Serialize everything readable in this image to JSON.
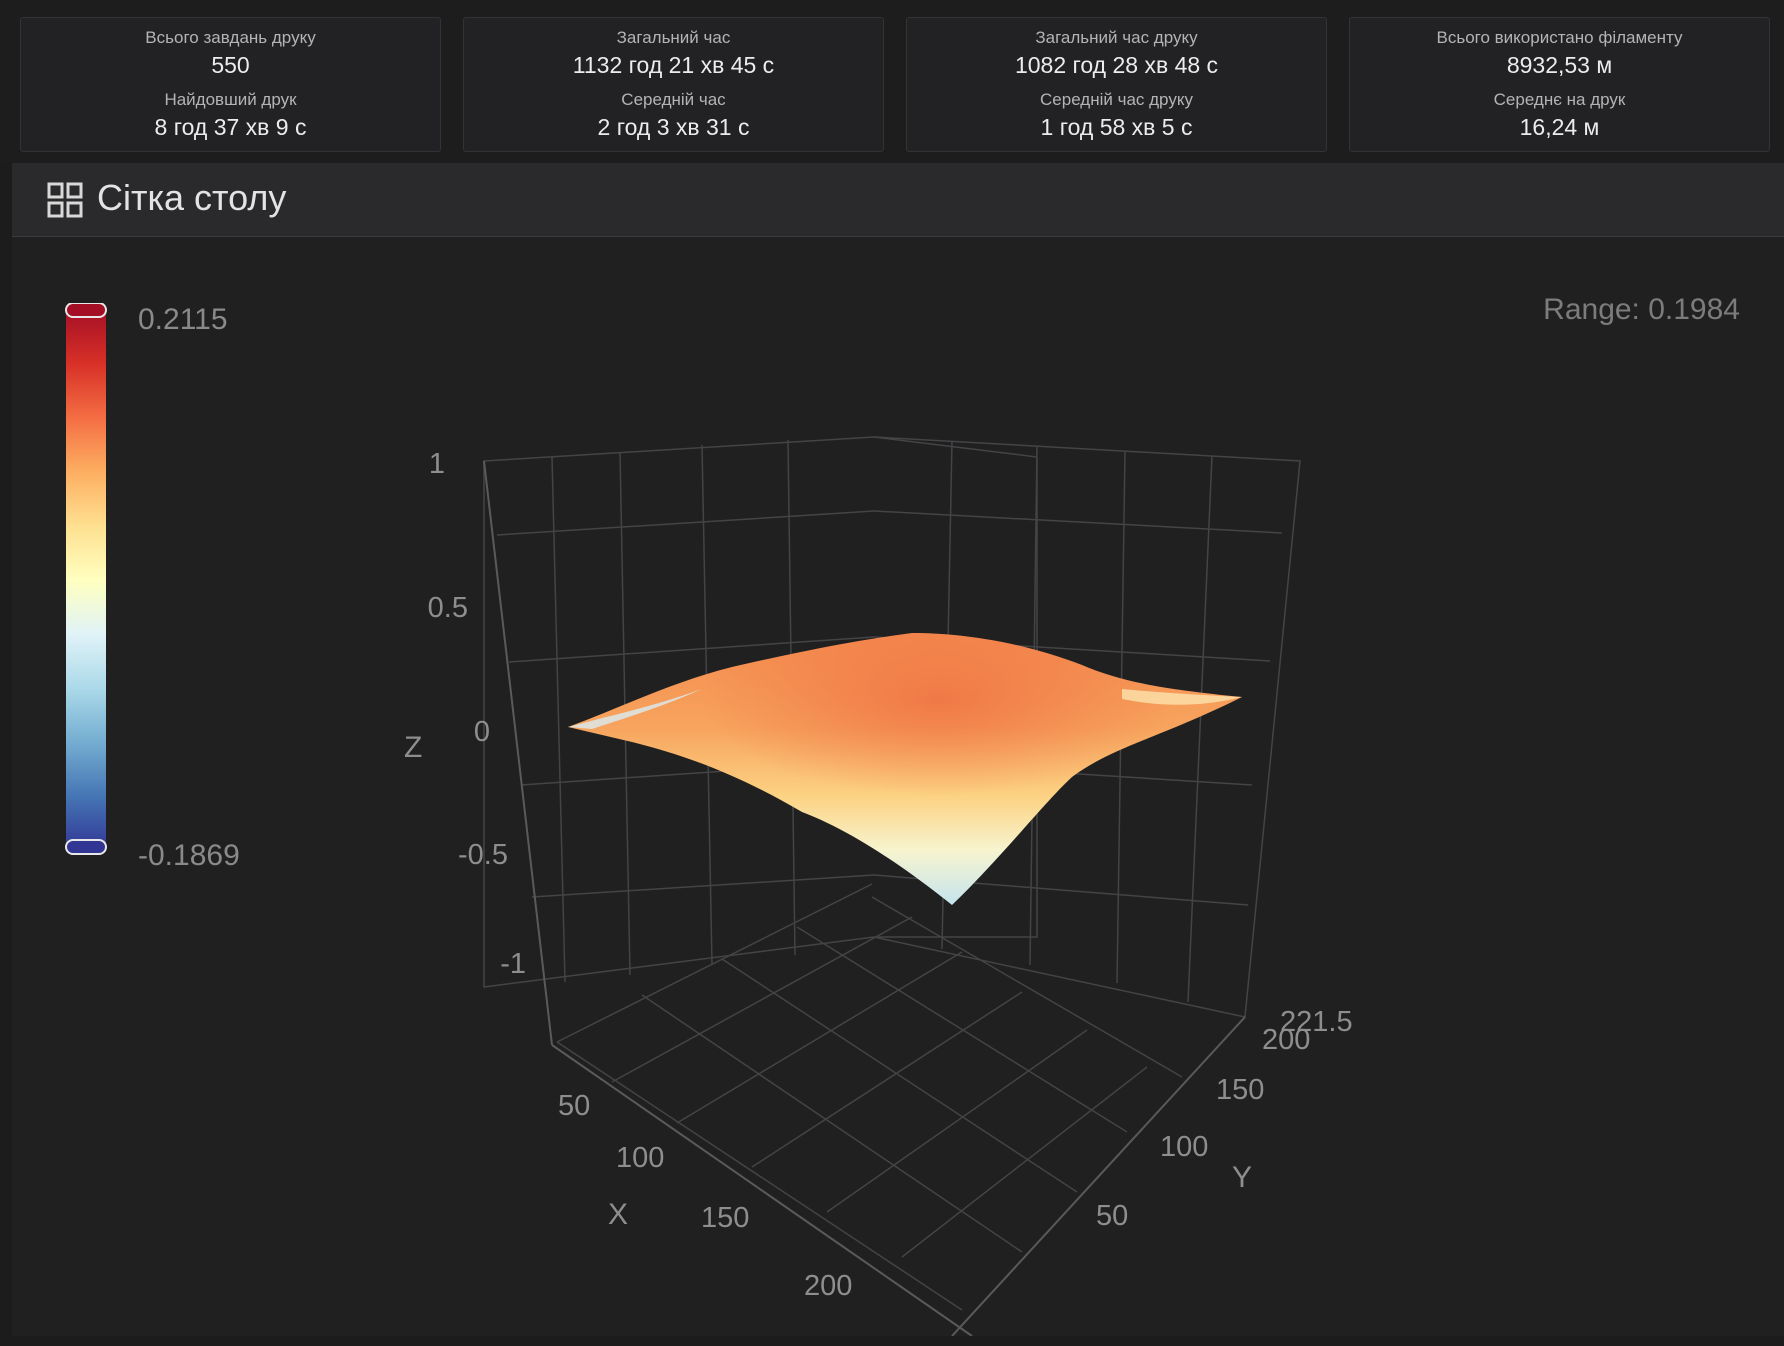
{
  "stats": [
    {
      "label1": "Всього завдань друку",
      "value1": "550",
      "label2": "Найдовший друк",
      "value2": "8 год 37 хв 9 с"
    },
    {
      "label1": "Загальний час",
      "value1": "1132 год 21 хв 45 с",
      "label2": "Середній час",
      "value2": "2 год 3 хв 31 с"
    },
    {
      "label1": "Загальний час друку",
      "value1": "1082 год 28 хв 48 с",
      "label2": "Середній час друку",
      "value2": "1 год 58 хв 5 с"
    },
    {
      "label1": "Всього використано філаменту",
      "value1": "8932,53 м",
      "label2": "Середнє на друк",
      "value2": "16,24 м"
    }
  ],
  "panel": {
    "title": "Сітка столу",
    "icon": "grid-view-icon",
    "range_label": "Range: 0.1984"
  },
  "colorbar": {
    "max_label": "0.2115",
    "min_label": "-0.1869",
    "colors": [
      "#a50f26",
      "#d73027",
      "#f46d43",
      "#fdae61",
      "#fee090",
      "#ffffbf",
      "#e0f3f8",
      "#abd9e9",
      "#74add1",
      "#4575b4",
      "#313695"
    ]
  },
  "axes": {
    "z_ticks": [
      "1",
      "0.5",
      "0",
      "-0.5",
      "-1"
    ],
    "z_title": "Z",
    "x_ticks": [
      "50",
      "100",
      "150",
      "200"
    ],
    "x_title": "X",
    "y_ticks": [
      "50",
      "100",
      "150",
      "200",
      "221.5"
    ],
    "y_title": "Y"
  }
}
